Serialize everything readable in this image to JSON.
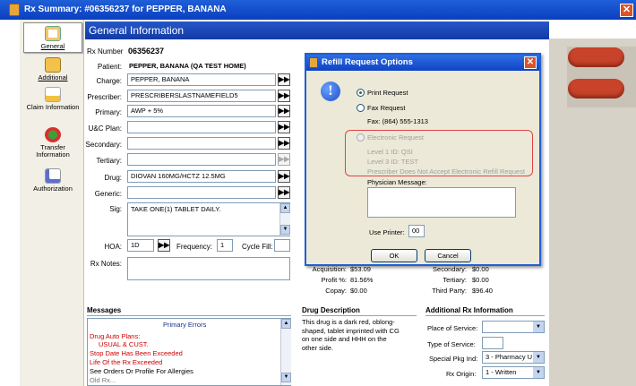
{
  "window": {
    "title": "Rx Summary: #06356237 for PEPPER, BANANA",
    "close_symbol": "✕"
  },
  "sidebar": {
    "items": [
      {
        "label": "General"
      },
      {
        "label": "Additional"
      },
      {
        "label": "Claim Information"
      },
      {
        "label": "Transfer Information"
      },
      {
        "label": "Authorization"
      }
    ]
  },
  "header": {
    "title": "General Information"
  },
  "form": {
    "rx_number_label": "Rx Number",
    "rx_number": "06356237",
    "patient_label": "Patient:",
    "patient": "PEPPER, BANANA (QA TEST HOME)",
    "charge_label": "Charge:",
    "charge": "PEPPER, BANANA",
    "prescriber_label": "Prescriber:",
    "prescriber": "PRESCRIBERSLASTNAMEFIELD5",
    "primary_label": "Primary:",
    "primary": "AWP + 5%",
    "uc_plan_label": "U&C Plan:",
    "uc_plan": "",
    "secondary_label": "Secondary:",
    "secondary": "",
    "tertiary_label": "Tertiary:",
    "tertiary": "",
    "drug_label": "Drug:",
    "drug": "DIOVAN 160MG/HCTZ 12.5MG",
    "generic_label": "Generic:",
    "generic": "",
    "sig_label": "Sig:",
    "sig": "TAKE ONE(1) TABLET DAILY.",
    "hoa_label": "HOA:",
    "hoa": "1D",
    "frequency_label": "Frequency:",
    "frequency": "1",
    "cycle_fill_label": "Cycle Fill:",
    "cycle_fill": "",
    "rx_notes_label": "Rx Notes:",
    "rx_notes": ""
  },
  "pricing": {
    "acquisition_label": "Acquisition:",
    "acquisition": "$53.09",
    "profit_label": "Profit %:",
    "profit": "81.56%",
    "copay_label": "Copay:",
    "copay": "$0.00",
    "secondary_label": "Secondary:",
    "secondary": "$0.00",
    "tertiary_label": "Tertiary:",
    "tertiary": "$0.00",
    "third_party_label": "Third Party:",
    "third_party": "$96.40"
  },
  "messages": {
    "title": "Messages",
    "header": "Primary Errors",
    "lines": [
      "Drug Auto Plans:",
      "USUAL & CUST.",
      "Stop Date Has Been Exceeded",
      "Life Of the Rx Exceeded",
      "See Orders Or Profile For Allergies"
    ],
    "truncated_line": "Old Rx..."
  },
  "drug_description": {
    "title": "Drug Description",
    "text": "This drug is a dark red, oblong-shaped, tablet imprinted with CG on one side and HHH on the other side."
  },
  "additional_rx": {
    "title": "Additional Rx Information",
    "place_label": "Place of Service:",
    "place": "",
    "type_label": "Type of Service:",
    "type": "",
    "special_pkg_label": "Special Pkg Ind:",
    "special_pkg": "3 - Pharmacy U",
    "rx_origin_label": "Rx Origin:",
    "rx_origin": "1 - Written"
  },
  "dialog": {
    "title": "Refill Request Options",
    "print_request": "Print Request",
    "fax_request": "Fax Request",
    "fax": "Fax: (864) 555-1313",
    "electronic_request": "Electronic Request",
    "level1": "Level 1 ID: QSI",
    "level3": "Level 3 ID: TEST",
    "prescriber_note": "Prescriber Does Not Accept Electronic Refill Request",
    "physician_message_label": "Physician Message:",
    "physician_message": "",
    "use_printer_label": "Use Printer:",
    "use_printer": "00",
    "ok_label": "OK",
    "cancel_label": "Cancel"
  }
}
